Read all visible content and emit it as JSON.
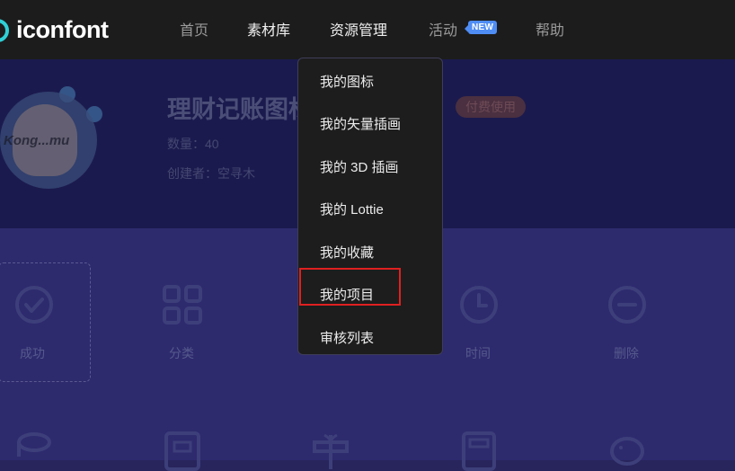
{
  "header": {
    "logo_text": "iconfont",
    "nav": [
      {
        "label": "首页"
      },
      {
        "label": "素材库"
      },
      {
        "label": "资源管理"
      },
      {
        "label": "活动",
        "badge": "NEW"
      },
      {
        "label": "帮助"
      }
    ]
  },
  "banner": {
    "title": "理财记账图标",
    "count": "数量：40",
    "creator": "创建者：空寻木",
    "fee_badge": "付费使用",
    "avatar_text": "Kong...mu"
  },
  "dropdown": {
    "items": [
      {
        "label": "我的图标"
      },
      {
        "label": "我的矢量插画"
      },
      {
        "label": "我的 3D 插画"
      },
      {
        "label": "我的 Lottie"
      },
      {
        "label": "我的收藏"
      },
      {
        "label": "我的项目"
      },
      {
        "label": "审核列表"
      }
    ]
  },
  "icons": [
    {
      "label": "成功",
      "icon": "check-circle-icon"
    },
    {
      "label": "分类",
      "icon": "category-icon"
    },
    {
      "label": "时间",
      "icon": "clock-icon"
    },
    {
      "label": "删除",
      "icon": "minus-circle-icon"
    }
  ],
  "colors": {
    "accent": "#2fd0d6",
    "badge_new": "#4f8df5",
    "highlight": "#e02020",
    "banner_bg": "#1b1a4e",
    "grid_bg": "#2e2a6e"
  }
}
